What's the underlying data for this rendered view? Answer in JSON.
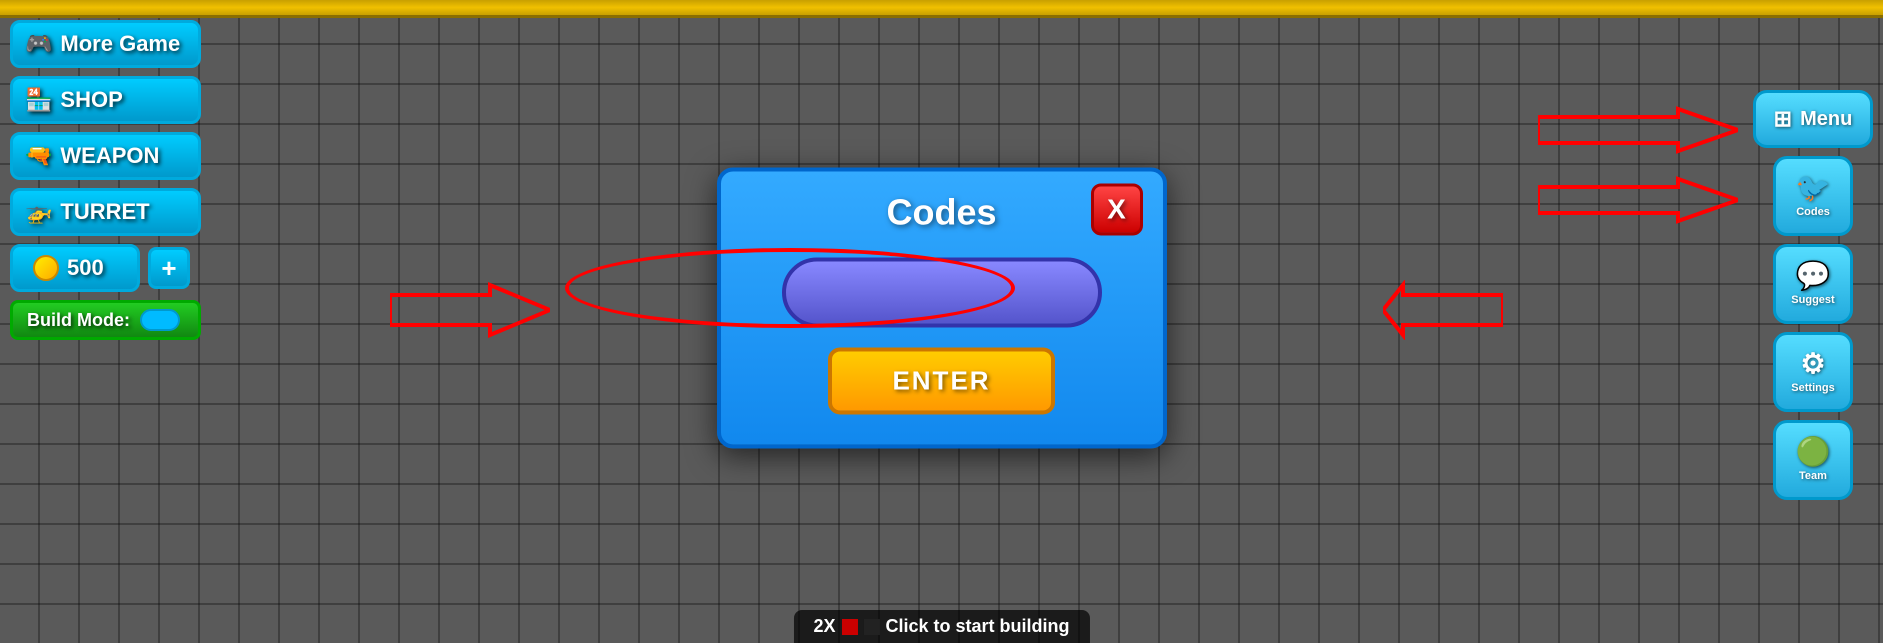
{
  "background": {
    "color": "#5a5a5a"
  },
  "left_sidebar": {
    "buttons": [
      {
        "id": "more-game",
        "icon": "🎮",
        "label": "More Game"
      },
      {
        "id": "shop",
        "icon": "🏪",
        "label": "SHOP"
      },
      {
        "id": "weapon",
        "icon": "🔫",
        "label": "WEAPON"
      },
      {
        "id": "turret",
        "icon": "🚁",
        "label": "TURRET"
      }
    ],
    "coin_amount": "500",
    "plus_label": "+",
    "build_mode_label": "Build Mode:"
  },
  "modal": {
    "title": "Codes",
    "close_label": "X",
    "input_placeholder": "",
    "enter_label": "ENTER"
  },
  "right_sidebar": {
    "menu_label": "Menu",
    "menu_icon": "⊞",
    "buttons": [
      {
        "id": "codes",
        "icon": "🐦",
        "label": "Codes"
      },
      {
        "id": "suggest",
        "icon": "💬",
        "label": "Suggest"
      },
      {
        "id": "settings",
        "icon": "⚙",
        "label": "Settings"
      },
      {
        "id": "team",
        "icon": "🟢",
        "label": "Team"
      }
    ]
  },
  "status_bar": {
    "text": "2X  ■■Click to start building"
  }
}
